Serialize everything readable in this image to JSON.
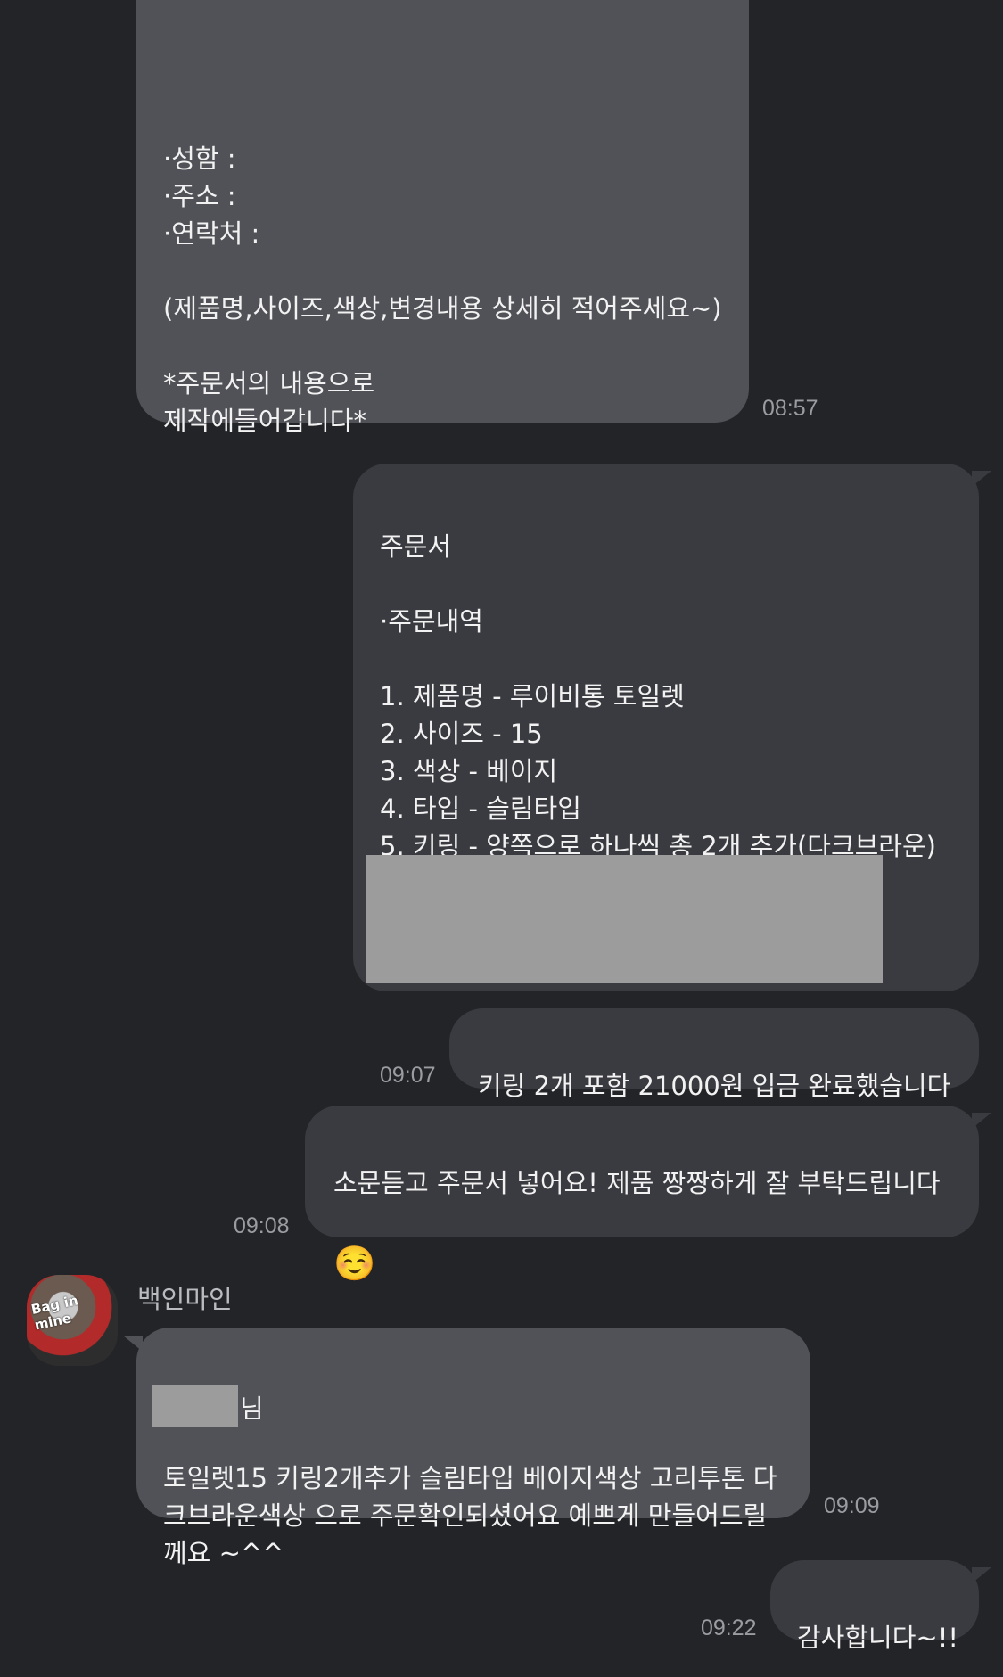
{
  "messages": {
    "m1": {
      "text": "·성함 :\n·주소 :\n·연락처 :\n\n(제품명,사이즈,색상,변경내용 상세히 적어주세요~)\n\n*주문서의 내용으로\n제작에들어갑니다*",
      "time": "08:57"
    },
    "m2": {
      "text": "주문서\n\n·주문내역\n\n1. 제품명 - 루이비통 토일렛\n2. 사이즈 - 15\n3. 색상 - 베이지\n4. 타입 - 슬림타입\n5. 키링 - 양쪽으로 하나씩 총 2개 추가(다크브라운)"
    },
    "m3": {
      "text": "키링 2개 포함 21000원 입금 완료했습니다",
      "time": "09:07"
    },
    "m4": {
      "text": "소문듣고 주문서 넣어요! 제품 짱짱하게 잘 부탁드립니다",
      "emoji": "☺️",
      "time": "09:08"
    },
    "m5": {
      "sender": "백인마인",
      "avatar_label": "Bag in mine",
      "salutation": "님",
      "text": "토일렛15 키링2개추가 슬림타입 베이지색상 고리투톤 다\n크브라운색상 으로 주문확인되셨어요 예쁘게 만들어드릴\n께요 ~^^",
      "time": "09:09"
    },
    "m6": {
      "text": "감사합니다~!!",
      "time": "09:22"
    }
  },
  "colors": {
    "background": "#232428",
    "incoming_bubble": "#505257",
    "outgoing_bubble": "#3a3b40",
    "timestamp": "#9a9ca1",
    "redaction": "#9c9c9c"
  }
}
